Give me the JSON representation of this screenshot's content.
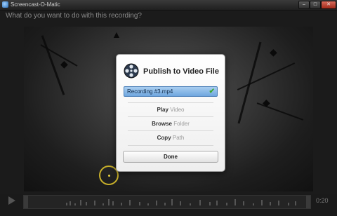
{
  "window": {
    "title": "Screencast-O-Matic",
    "minimize_label": "–",
    "maximize_label": "□",
    "close_label": "✕"
  },
  "prompt": "What do you want to do with this recording?",
  "dialog": {
    "heading": "Publish to Video File",
    "icon": "film-reel-icon",
    "file_name": "Recording #3.mp4",
    "file_status_icon": "checkmark-icon",
    "actions": [
      {
        "verb": "Play",
        "object": "Video"
      },
      {
        "verb": "Browse",
        "object": "Folder"
      },
      {
        "verb": "Copy",
        "object": "Path"
      }
    ],
    "done_label": "Done"
  },
  "player": {
    "time": "0:20",
    "play_icon": "play-icon"
  },
  "colors": {
    "file_field": "#6fa6df",
    "check": "#3aa830",
    "cursor_highlight": "#c8b02a",
    "close_button": "#a02818"
  }
}
